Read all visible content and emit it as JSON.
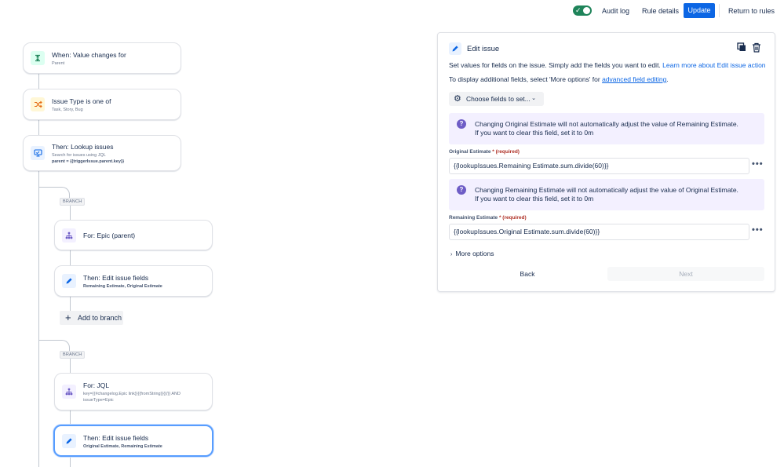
{
  "topbar": {
    "audit_log": "Audit log",
    "rule_details": "Rule details",
    "update": "Update",
    "return_to_rules": "Return to rules",
    "toggle_check": "✓",
    "toggle_on": true
  },
  "flow": {
    "trigger": {
      "title": "When: Value changes for",
      "subtitle": "Parent",
      "icon": "value-changes-icon"
    },
    "condition": {
      "title": "Issue Type is one of",
      "subtitle": "Task, Story, Bug",
      "icon": "shuffle-icon"
    },
    "lookup": {
      "title": "Then: Lookup issues",
      "subtitle": "Search for issues using JQL",
      "detail": "parent = {{triggerIssue.parent.key}}",
      "icon": "monitor-icon"
    },
    "branch_label": "BRANCH",
    "branch1": {
      "for": {
        "title": "For: Epic (parent)",
        "icon": "hierarchy-icon"
      },
      "edit": {
        "title": "Then: Edit issue fields",
        "detail": "Remaining Estimate, Original Estimate",
        "icon": "pencil-icon"
      },
      "add_to_branch": "Add to branch"
    },
    "branch2": {
      "for": {
        "title": "For: JQL",
        "subtitle_line1": "key={{#changelog.Epic link}}{{fromString}}{{/}} AND",
        "subtitle_line2": "issueType=Epic",
        "icon": "hierarchy-icon"
      },
      "edit": {
        "title": "Then: Edit issue fields",
        "detail": "Original Estimate, Remaining Estimate",
        "icon": "pencil-icon"
      }
    }
  },
  "panel": {
    "title": "Edit issue",
    "description": "Set values for fields on the issue. Simply add the fields you want to edit.",
    "learn_more": "Learn more about Edit issue action",
    "display_note": "To display additional fields, select 'More options' for",
    "advanced_link": "advanced field editing",
    "display_note_end": ".",
    "choose_fields": "Choose fields to set...",
    "info1": {
      "line1": "Changing Original Estimate will not automatically adjust the value of Remaining Estimate.",
      "line2": "If you want to clear this field, set it to 0m"
    },
    "field1": {
      "label": "Original Estimate",
      "required": "* (required)",
      "value": "{{lookupIssues.Remaining Estimate.sum.divide(60)}}"
    },
    "info2": {
      "line1": "Changing Remaining Estimate will not automatically adjust the value of Original Estimate.",
      "line2": "If you want to clear this field, set it to 0m"
    },
    "field2": {
      "label": "Remaining Estimate",
      "required": "* (required)",
      "value": "{{lookupIssues.Original Estimate.sum.divide(60)}}"
    },
    "more_options": "More options",
    "back": "Back",
    "next": "Next",
    "ellipsis": "•••",
    "info_glyph": "?"
  }
}
